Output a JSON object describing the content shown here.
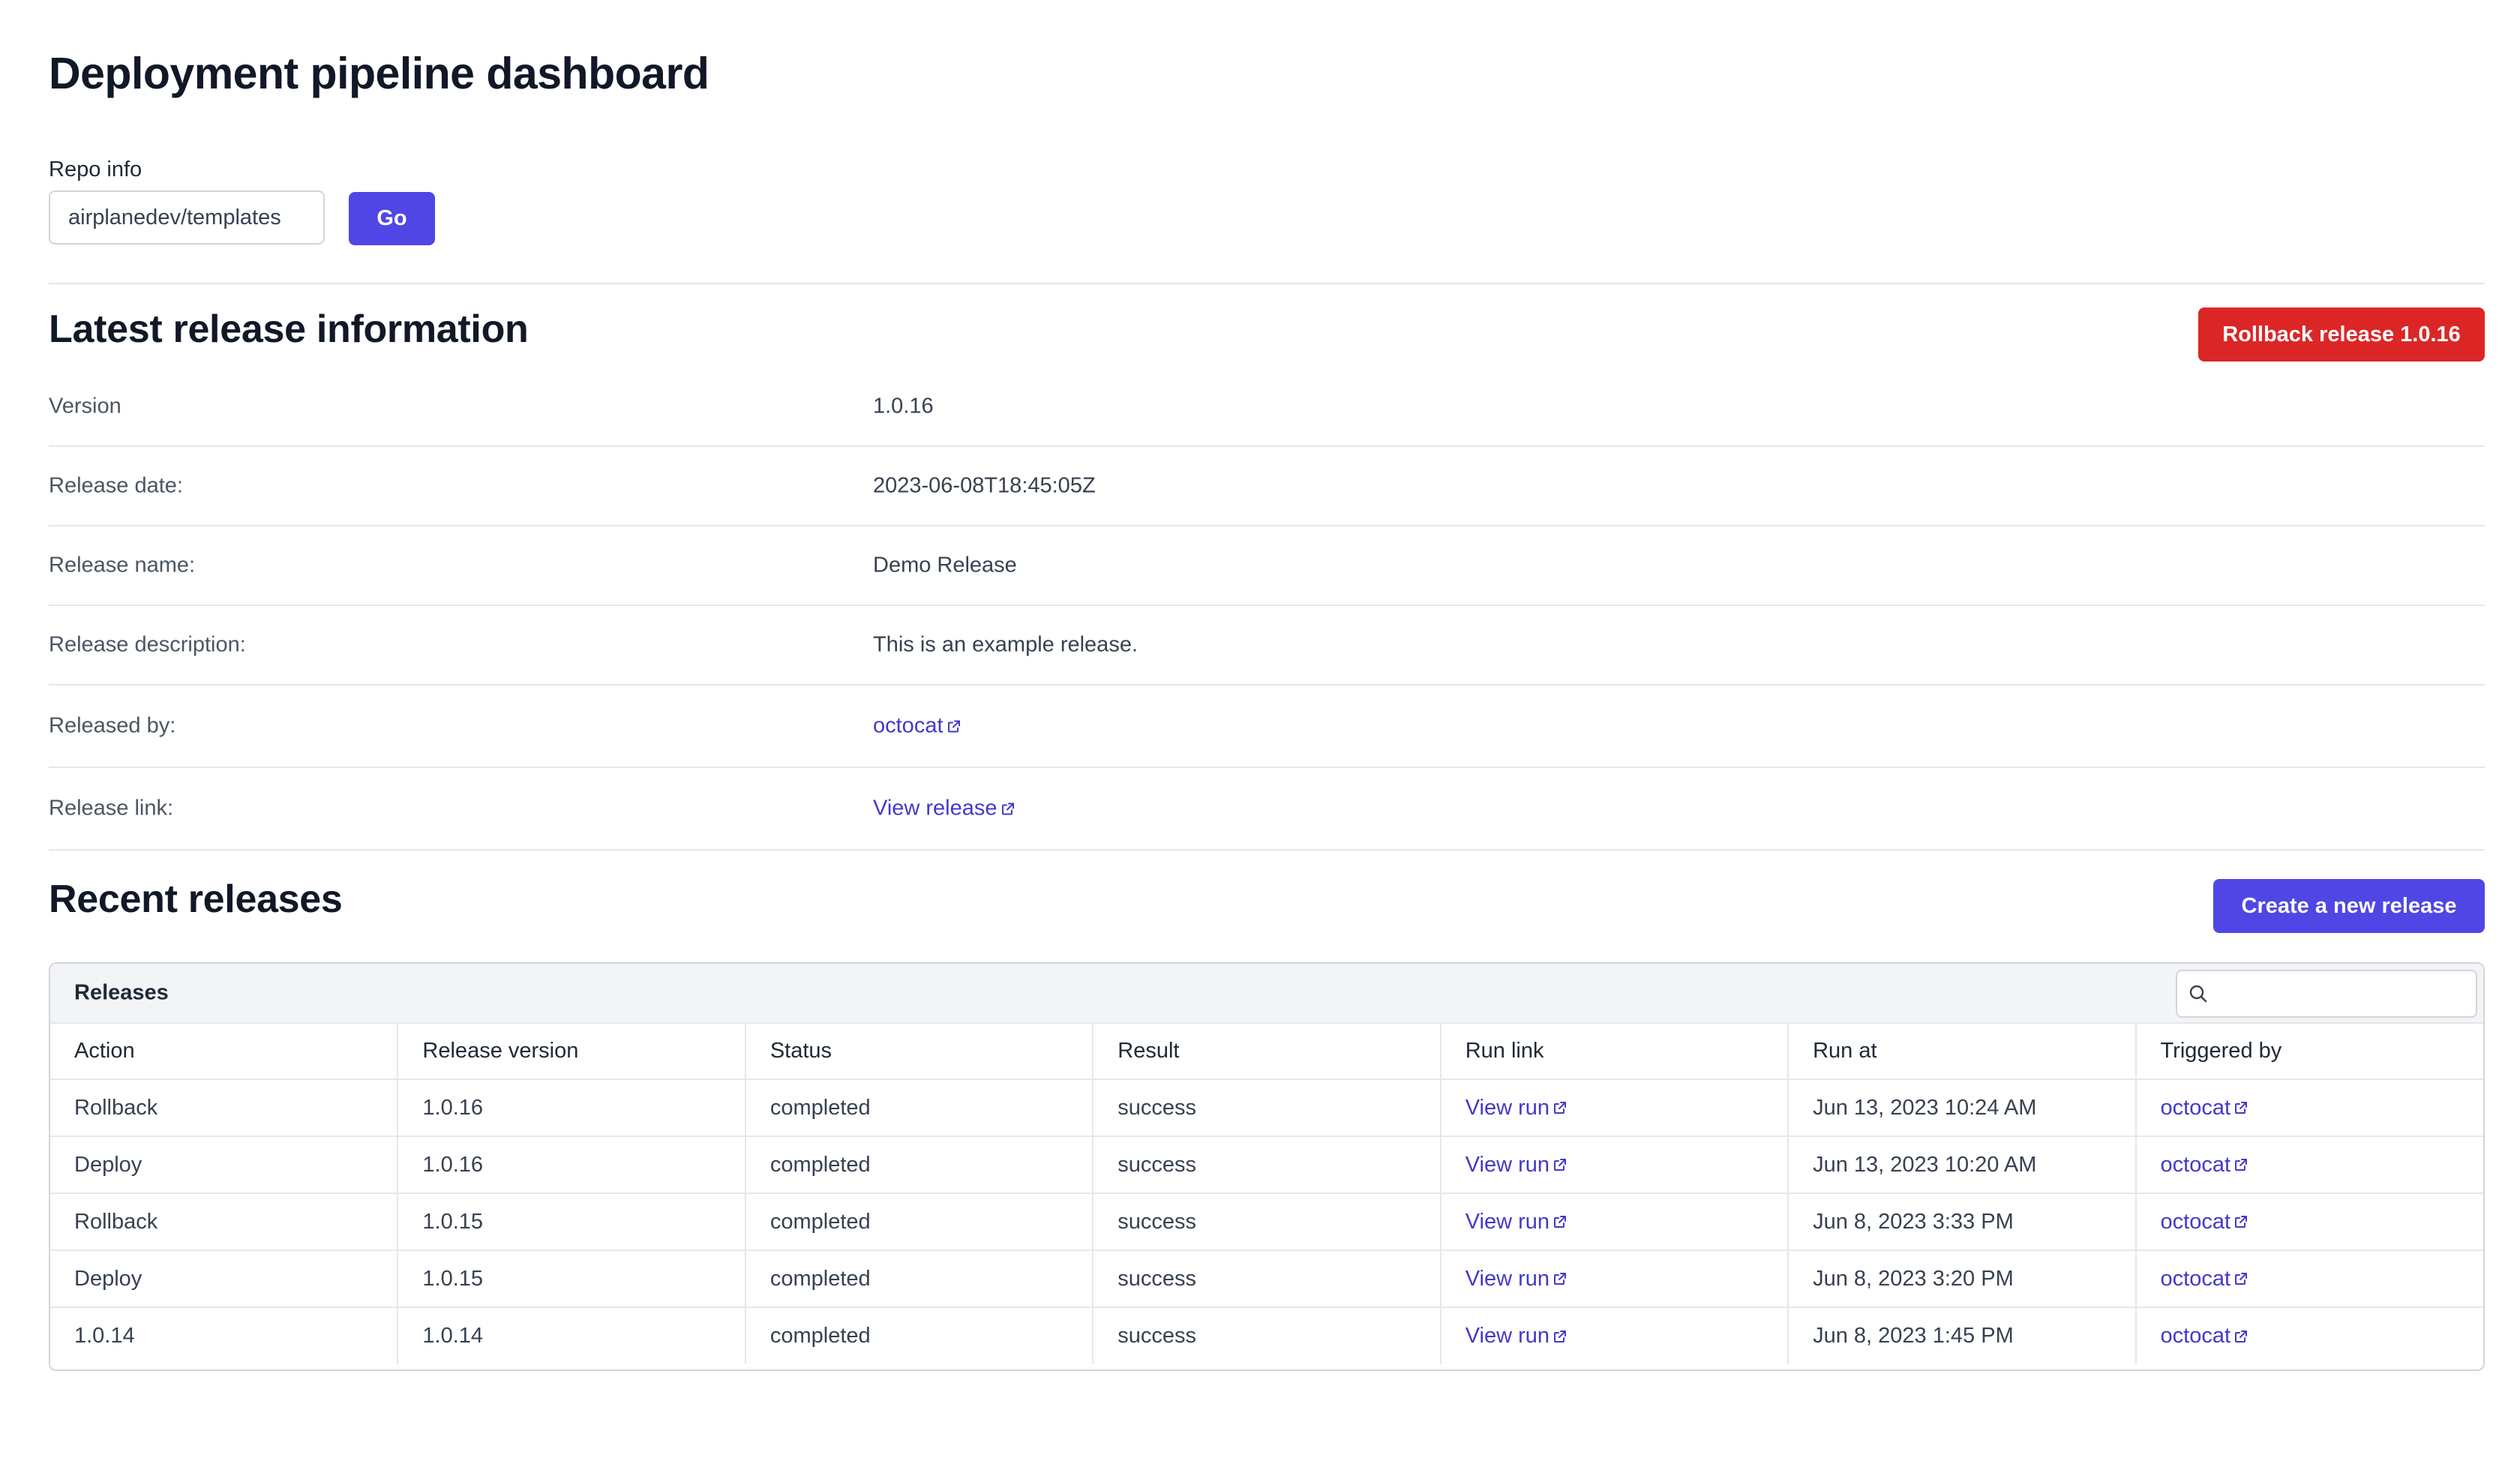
{
  "page": {
    "title": "Deployment pipeline dashboard"
  },
  "repo": {
    "label": "Repo info",
    "value": "airplanedev/templates",
    "go_label": "Go"
  },
  "latest_release": {
    "title": "Latest release information",
    "rollback_label": "Rollback release 1.0.16",
    "rows": [
      {
        "label": "Version",
        "value": "1.0.16"
      },
      {
        "label": "Release date:",
        "value": "2023-06-08T18:45:05Z"
      },
      {
        "label": "Release name:",
        "value": "Demo Release"
      },
      {
        "label": "Release description:",
        "value": "This is an example release."
      },
      {
        "label": "Released by:",
        "value": "octocat"
      },
      {
        "label": "Release link:",
        "value": "View release"
      }
    ]
  },
  "recent_releases": {
    "title": "Recent releases",
    "create_label": "Create a new release",
    "table_title": "Releases",
    "search_placeholder": "",
    "columns": [
      "Action",
      "Release version",
      "Status",
      "Result",
      "Run link",
      "Run at",
      "Triggered by"
    ],
    "rows": [
      {
        "action": "Rollback",
        "version": "1.0.16",
        "status": "completed",
        "result": "success",
        "run_link": "View run",
        "run_at": "Jun 13, 2023 10:24 AM",
        "triggered_by": "octocat"
      },
      {
        "action": "Deploy",
        "version": "1.0.16",
        "status": "completed",
        "result": "success",
        "run_link": "View run",
        "run_at": "Jun 13, 2023 10:20 AM",
        "triggered_by": "octocat"
      },
      {
        "action": "Rollback",
        "version": "1.0.15",
        "status": "completed",
        "result": "success",
        "run_link": "View run",
        "run_at": "Jun 8, 2023 3:33 PM",
        "triggered_by": "octocat"
      },
      {
        "action": "Deploy",
        "version": "1.0.15",
        "status": "completed",
        "result": "success",
        "run_link": "View run",
        "run_at": "Jun 8, 2023 3:20 PM",
        "triggered_by": "octocat"
      },
      {
        "action": "1.0.14",
        "version": "1.0.14",
        "status": "completed",
        "result": "success",
        "run_link": "View run",
        "run_at": "Jun 8, 2023 1:45 PM",
        "triggered_by": "octocat"
      }
    ]
  },
  "colors": {
    "primary": "#4f46e5",
    "danger": "#dc2626",
    "link": "#4338ca",
    "border": "#e5e7eb"
  }
}
